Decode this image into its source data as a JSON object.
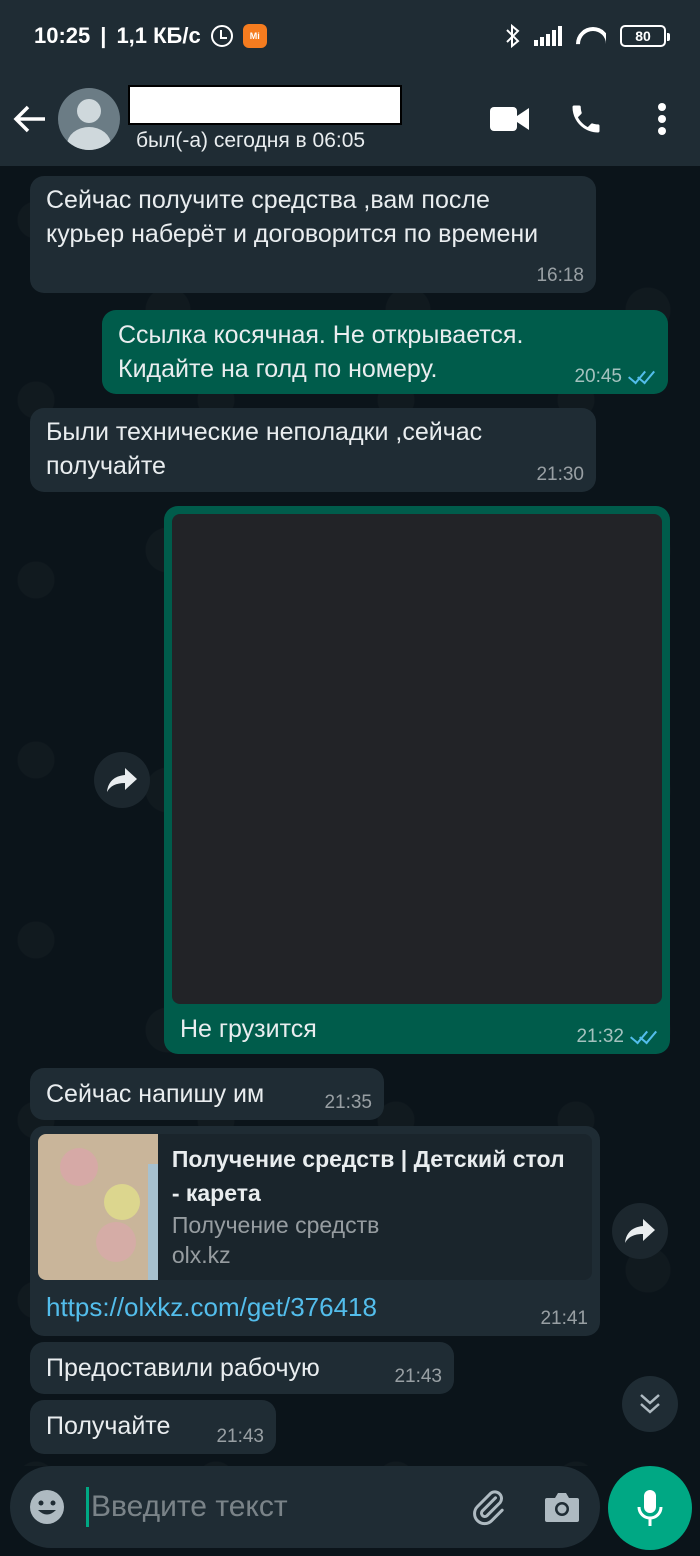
{
  "status_bar": {
    "time": "10:25",
    "network_speed": "1,1 КБ/с",
    "app_badge": "Mi",
    "battery": "80"
  },
  "header": {
    "contact_status": "был(-а) сегодня в 06:05",
    "icons": [
      "back-arrow-icon",
      "video-call-icon",
      "phone-icon",
      "more-vert-icon"
    ]
  },
  "messages": [
    {
      "type": "incoming",
      "text": "Сейчас получите средства ,вам после курьер наберёт и договорится по времени",
      "time": "16:18"
    },
    {
      "type": "outgoing",
      "text": "Ссылка косячная. Не открывается. Кидайте на голд по номеру.",
      "time": "20:45",
      "status": "read"
    },
    {
      "type": "incoming",
      "text": "Были технические неполадки ,сейчас получайте",
      "time": "21:30"
    },
    {
      "type": "outgoing_image",
      "caption": "Не грузится",
      "time": "21:32",
      "status": "read"
    },
    {
      "type": "incoming",
      "text": "Сейчас напишу им",
      "time": "21:35"
    },
    {
      "type": "incoming_link",
      "preview_title": "Получение средств | Детский стол - карета",
      "preview_description": "Получение средств",
      "preview_domain": "olx.kz",
      "url": "https://olxkz.com/get/376418",
      "time": "21:41"
    },
    {
      "type": "incoming",
      "text": "Предоставили рабочую",
      "time": "21:43"
    },
    {
      "type": "incoming",
      "text": "Получайте",
      "time": "21:43"
    }
  ],
  "input": {
    "placeholder": "Введите текст",
    "value": ""
  },
  "colors": {
    "header_bg": "#1f2c34",
    "chat_bg": "#0b141a",
    "incoming_bubble": "#1f2c34",
    "outgoing_bubble": "#005c4b",
    "accent": "#00a884",
    "link": "#53bdeb"
  }
}
